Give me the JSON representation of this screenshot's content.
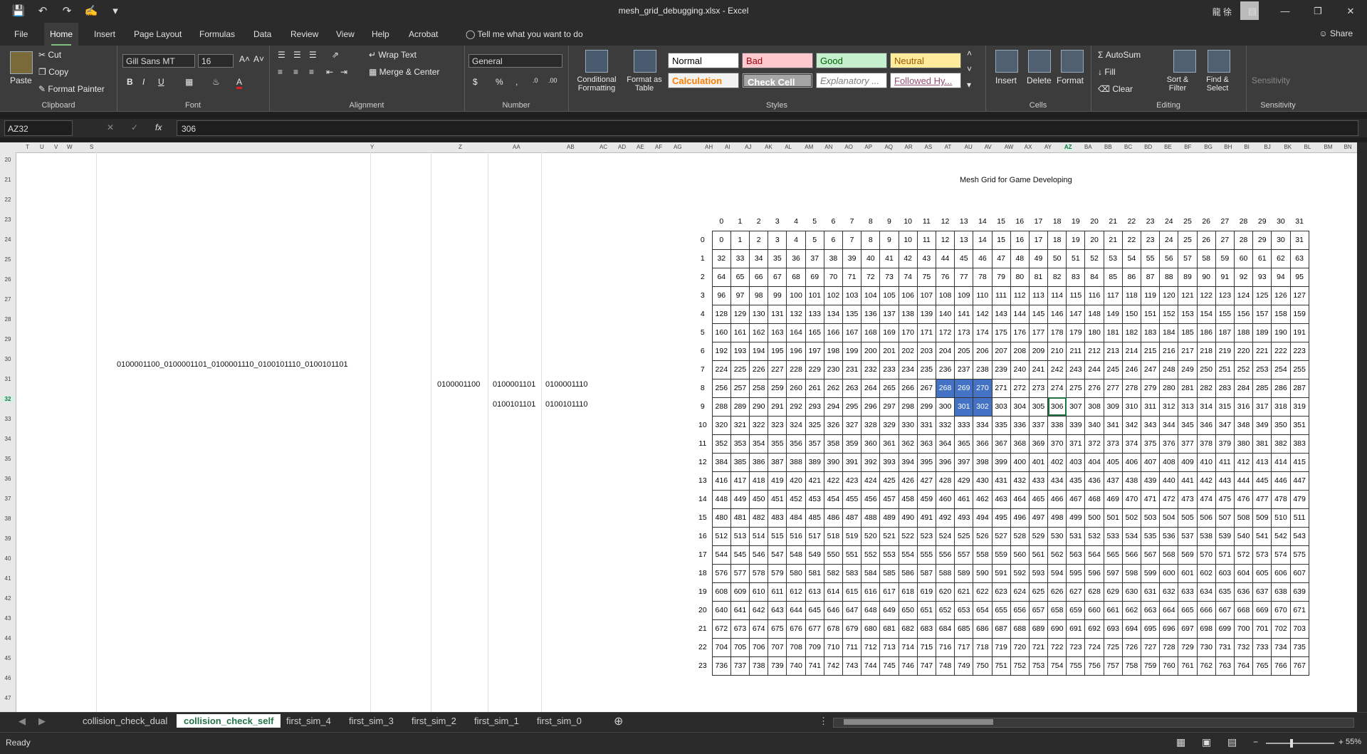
{
  "window": {
    "title": "mesh_grid_debugging.xlsx - Excel",
    "user": "龍 徐"
  },
  "qat": [
    "save",
    "undo",
    "redo",
    "touch",
    "customize"
  ],
  "tabs": [
    "File",
    "Home",
    "Insert",
    "Page Layout",
    "Formulas",
    "Data",
    "Review",
    "View",
    "Help",
    "Acrobat",
    "Tell me what you want to do"
  ],
  "share_label": "Share",
  "ribbon": {
    "clipboard": {
      "label": "Clipboard",
      "paste": "Paste",
      "cut": "Cut",
      "copy": "Copy",
      "format_painter": "Format Painter"
    },
    "font": {
      "label": "Font",
      "name": "Gill Sans MT",
      "size": "16"
    },
    "alignment": {
      "label": "Alignment",
      "wrap": "Wrap Text",
      "merge": "Merge & Center"
    },
    "number": {
      "label": "Number",
      "format": "General"
    },
    "styles": {
      "label": "Styles",
      "conditional": "Conditional Formatting",
      "format_table": "Format as Table",
      "normal": "Normal",
      "bad": "Bad",
      "good": "Good",
      "neutral": "Neutral",
      "calculation": "Calculation",
      "check_cell": "Check Cell",
      "explanatory": "Explanatory ...",
      "followed": "Followed Hy..."
    },
    "cells": {
      "label": "Cells",
      "insert": "Insert",
      "delete": "Delete",
      "format": "Format"
    },
    "editing": {
      "label": "Editing",
      "autosum": "AutoSum",
      "fill": "Fill",
      "clear": "Clear",
      "sort": "Sort & Filter",
      "find": "Find & Select"
    },
    "sensitivity": {
      "label": "Sensitivity",
      "button": "Sensitivity"
    }
  },
  "formula_bar": {
    "name_box": "AZ32",
    "value": "306"
  },
  "sheet": {
    "grid_title": "Mesh Grid for Game Developing",
    "binary_long": "0100001100_0100001101_0100001110_0100101110_0100101101",
    "binary_cells": [
      "0100001100",
      "0100001101",
      "0100001110",
      "0100101101",
      "0100101110"
    ],
    "column_headers": [
      "T",
      "U",
      "V",
      "W",
      "S",
      "Y",
      "Z",
      "AA",
      "AB",
      "AC",
      "AD",
      "AE",
      "AF",
      "AG",
      "AH",
      "AI",
      "AJ",
      "AK",
      "AL",
      "AM",
      "AN",
      "AO",
      "AP",
      "AQ",
      "AR",
      "AS",
      "AT",
      "AU",
      "AV",
      "AW",
      "AX",
      "AY",
      "AZ",
      "BA",
      "BB",
      "BC",
      "BD",
      "BE",
      "BF",
      "BG",
      "BH",
      "BI",
      "BJ",
      "BK",
      "BL",
      "BM",
      "BN"
    ],
    "row_numbers": [
      20,
      21,
      22,
      23,
      24,
      25,
      26,
      27,
      28,
      29,
      30,
      31,
      32,
      33,
      34,
      35,
      36,
      37,
      38,
      39,
      40,
      41,
      42,
      43,
      44,
      45,
      46,
      47
    ],
    "grid_cols": 32,
    "grid_rows": 24,
    "selected_cells": [
      268,
      269,
      270,
      301,
      302
    ],
    "active_cell": 306
  },
  "sheet_tabs": [
    "collision_check_dual",
    "collision_check_self",
    "first_sim_4",
    "first_sim_3",
    "first_sim_2",
    "first_sim_1",
    "first_sim_0"
  ],
  "active_sheet_tab": "collision_check_self",
  "status": {
    "text": "Ready",
    "zoom": "55%"
  }
}
